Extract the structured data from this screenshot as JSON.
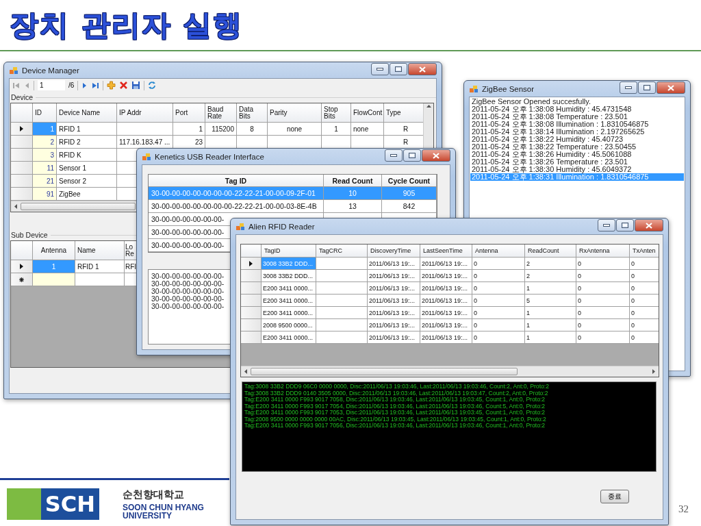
{
  "slide": {
    "title": "장치 관리자 실행",
    "page_number": "32"
  },
  "logo": {
    "mark": "SCH",
    "name_ko": "순천향대학교",
    "name_en": [
      "SOON CHUN HYANG",
      "UNIVERSITY"
    ]
  },
  "device_manager": {
    "title": "Device Manager",
    "toolbar": [
      {
        "kind": "first",
        "disabled": true
      },
      {
        "kind": "prev",
        "disabled": true
      },
      {
        "kind": "separator"
      },
      {
        "kind": "position",
        "value": "1"
      },
      {
        "kind": "count",
        "text": "/6"
      },
      {
        "kind": "separator"
      },
      {
        "kind": "next",
        "disabled": false
      },
      {
        "kind": "last",
        "disabled": false
      },
      {
        "kind": "separator"
      },
      {
        "kind": "add",
        "disabled": false
      },
      {
        "kind": "delete",
        "disabled": false
      },
      {
        "kind": "save",
        "disabled": false
      },
      {
        "kind": "separator"
      },
      {
        "kind": "refresh",
        "disabled": false
      }
    ],
    "device_label": "Device",
    "devices": {
      "columns": [
        "ID",
        "Device Name",
        "IP Addr",
        "Port",
        "Baud Rate",
        "Data Bits",
        "Parity",
        "Stop Bits",
        "FlowCont",
        "Type"
      ],
      "rows": [
        {
          "selected": true,
          "cells": [
            "1",
            "RFID 1",
            null,
            "1",
            "115200",
            "8",
            "none",
            "1",
            "none",
            "R"
          ]
        },
        {
          "selected": false,
          "cells": [
            "2",
            "RFID 2",
            "117.16.183.47 ...",
            "23",
            null,
            null,
            null,
            null,
            null,
            "R"
          ]
        },
        {
          "selected": false,
          "cells": [
            "3",
            "RFID K"
          ]
        },
        {
          "selected": false,
          "cells": [
            "11",
            "Sensor 1"
          ]
        },
        {
          "selected": false,
          "cells": [
            "21",
            "Sensor 2"
          ]
        },
        {
          "selected": false,
          "cells": [
            "91",
            "ZigBee"
          ]
        }
      ]
    },
    "sub_device_label": "Sub Device",
    "sub_devices": {
      "columns": [
        "Antenna",
        "Name",
        "Lo Re"
      ],
      "rows": [
        {
          "kind": "data",
          "selected": true,
          "cells": [
            "1",
            "RFID 1",
            "RFI"
          ]
        },
        {
          "kind": "new",
          "selected": false
        }
      ]
    }
  },
  "zigbee": {
    "title": "ZigBee Sensor",
    "log": [
      {
        "text": "ZigBee Sensor Opened succesfully.",
        "selected": false
      },
      {
        "text": "2011-05-24 오후 1:38:08 Humidity : 45.4731548",
        "selected": false
      },
      {
        "text": "2011-05-24 오후 1:38:08 Temperature : 23.501",
        "selected": false
      },
      {
        "text": "2011-05-24 오후 1:38:08 Illumination : 1.8310546875",
        "selected": false
      },
      {
        "text": "2011-05-24 오후 1:38:14 Illumination : 2.197265625",
        "selected": false
      },
      {
        "text": "2011-05-24 오후 1:38:22 Humidity : 45.40723",
        "selected": false
      },
      {
        "text": "2011-05-24 오후 1:38:22 Temperature : 23.50455",
        "selected": false
      },
      {
        "text": "2011-05-24 오후 1:38:26 Humidity : 45.5061088",
        "selected": false
      },
      {
        "text": "2011-05-24 오후 1:38:26 Temperature : 23.501",
        "selected": false
      },
      {
        "text": "2011-05-24 오후 1:38:30 Humidity : 45.6049372",
        "selected": false
      },
      {
        "text": "2011-05-24 오후 1:38:31 Illumination : 1.8310546875",
        "selected": true
      }
    ]
  },
  "kenetics": {
    "title": "Kenetics USB Reader Interface",
    "tags": {
      "columns": [
        "Tag ID",
        "Read Count",
        "Cycle Count"
      ],
      "rows": [
        {
          "selected": true,
          "cells": [
            "30-00-00-00-00-00-00-00-22-22-21-00-00-09-2F-01",
            "10",
            "905"
          ]
        },
        {
          "selected": false,
          "cells": [
            "30-00-00-00-00-00-00-00-22-22-21-00-00-03-8E-4B",
            "13",
            "842"
          ]
        },
        {
          "selected": false,
          "cells": [
            "30-00-00-00-00-00-00-"
          ]
        },
        {
          "selected": false,
          "cells": [
            "30-00-00-00-00-00-00-"
          ]
        },
        {
          "selected": false,
          "cells": [
            "30-00-00-00-00-00-00-"
          ]
        }
      ]
    },
    "log_lines": [
      "30-00-00-00-00-00-00-",
      "30-00-00-00-00-00-00-",
      "30-00-00-00-00-00-00-",
      "30-00-00-00-00-00-00-",
      "30-00-00-00-00-00-00-"
    ]
  },
  "alien": {
    "title": "Alien RFID Reader",
    "tags": {
      "columns": [
        "TagID",
        "TagCRC",
        "DiscoveryTime",
        "LastSeenTime",
        "Antenna",
        "ReadCount",
        "RxAntenna",
        "TxAnten"
      ],
      "rows": [
        {
          "selected": true,
          "cells": [
            "3008 33B2 DDD...",
            null,
            "2011/06/13 19:...",
            "2011/06/13 19:...",
            "0",
            "2",
            "0",
            "0"
          ]
        },
        {
          "selected": false,
          "cells": [
            "3008 33B2 DDD...",
            null,
            "2011/06/13 19:...",
            "2011/06/13 19:...",
            "0",
            "2",
            "0",
            "0"
          ]
        },
        {
          "selected": false,
          "cells": [
            "E200 3411 0000...",
            null,
            "2011/06/13 19:...",
            "2011/06/13 19:...",
            "0",
            "1",
            "0",
            "0"
          ]
        },
        {
          "selected": false,
          "cells": [
            "E200 3411 0000...",
            null,
            "2011/06/13 19:...",
            "2011/06/13 19:...",
            "0",
            "5",
            "0",
            "0"
          ]
        },
        {
          "selected": false,
          "cells": [
            "E200 3411 0000...",
            null,
            "2011/06/13 19:...",
            "2011/06/13 19:...",
            "0",
            "1",
            "0",
            "0"
          ]
        },
        {
          "selected": false,
          "cells": [
            "2008 9500 0000...",
            null,
            "2011/06/13 19:...",
            "2011/06/13 19:...",
            "0",
            "1",
            "0",
            "0"
          ]
        },
        {
          "selected": false,
          "cells": [
            "E200 3411 0000...",
            null,
            "2011/06/13 19:...",
            "2011/06/13 19:...",
            "0",
            "1",
            "0",
            "0"
          ]
        }
      ]
    },
    "console": [
      "Tag:3008 33B2 DDD9 06C0 0000 0000, Disc:2011/06/13 19:03:46, Last:2011/06/13 19:03:46, Count:2, Ant:0, Proto:2",
      "Tag:3008 33B2 DDD9 0140 3505 0000, Disc:2011/06/13 19:03:46, Last:2011/06/13 19:03:47, Count:2, Ant:0, Proto:2",
      "Tag:E200 3411 0000 F993 9017 7058, Disc:2011/06/13 19:03:46, Last:2011/06/13 19:03:45, Count:1, Ant:0, Proto:2",
      "Tag:E200 3411 0000 F993 9017 7054, Disc:2011/06/13 19:03:46, Last:2011/06/13 19:03:46, Count:5, Ant:0, Proto:2",
      "Tag:E200 3411 0000 F993 9017 7053, Disc:2011/06/13 19:03:46, Last:2011/06/13 19:03:45, Count:1, Ant:0, Proto:2",
      "Tag:2008 9500 0000 0000 0000 00AC, Disc:2011/06/13 19:03:45, Last:2011/06/13 19:03:45, Count:1, Ant:0, Proto:2",
      "Tag:E200 3411 0000 F993 9017 7056, Disc:2011/06/13 19:03:46, Last:2011/06/13 19:03:46, Count:1, Ant:0, Proto:2"
    ],
    "close_button": "종료"
  }
}
